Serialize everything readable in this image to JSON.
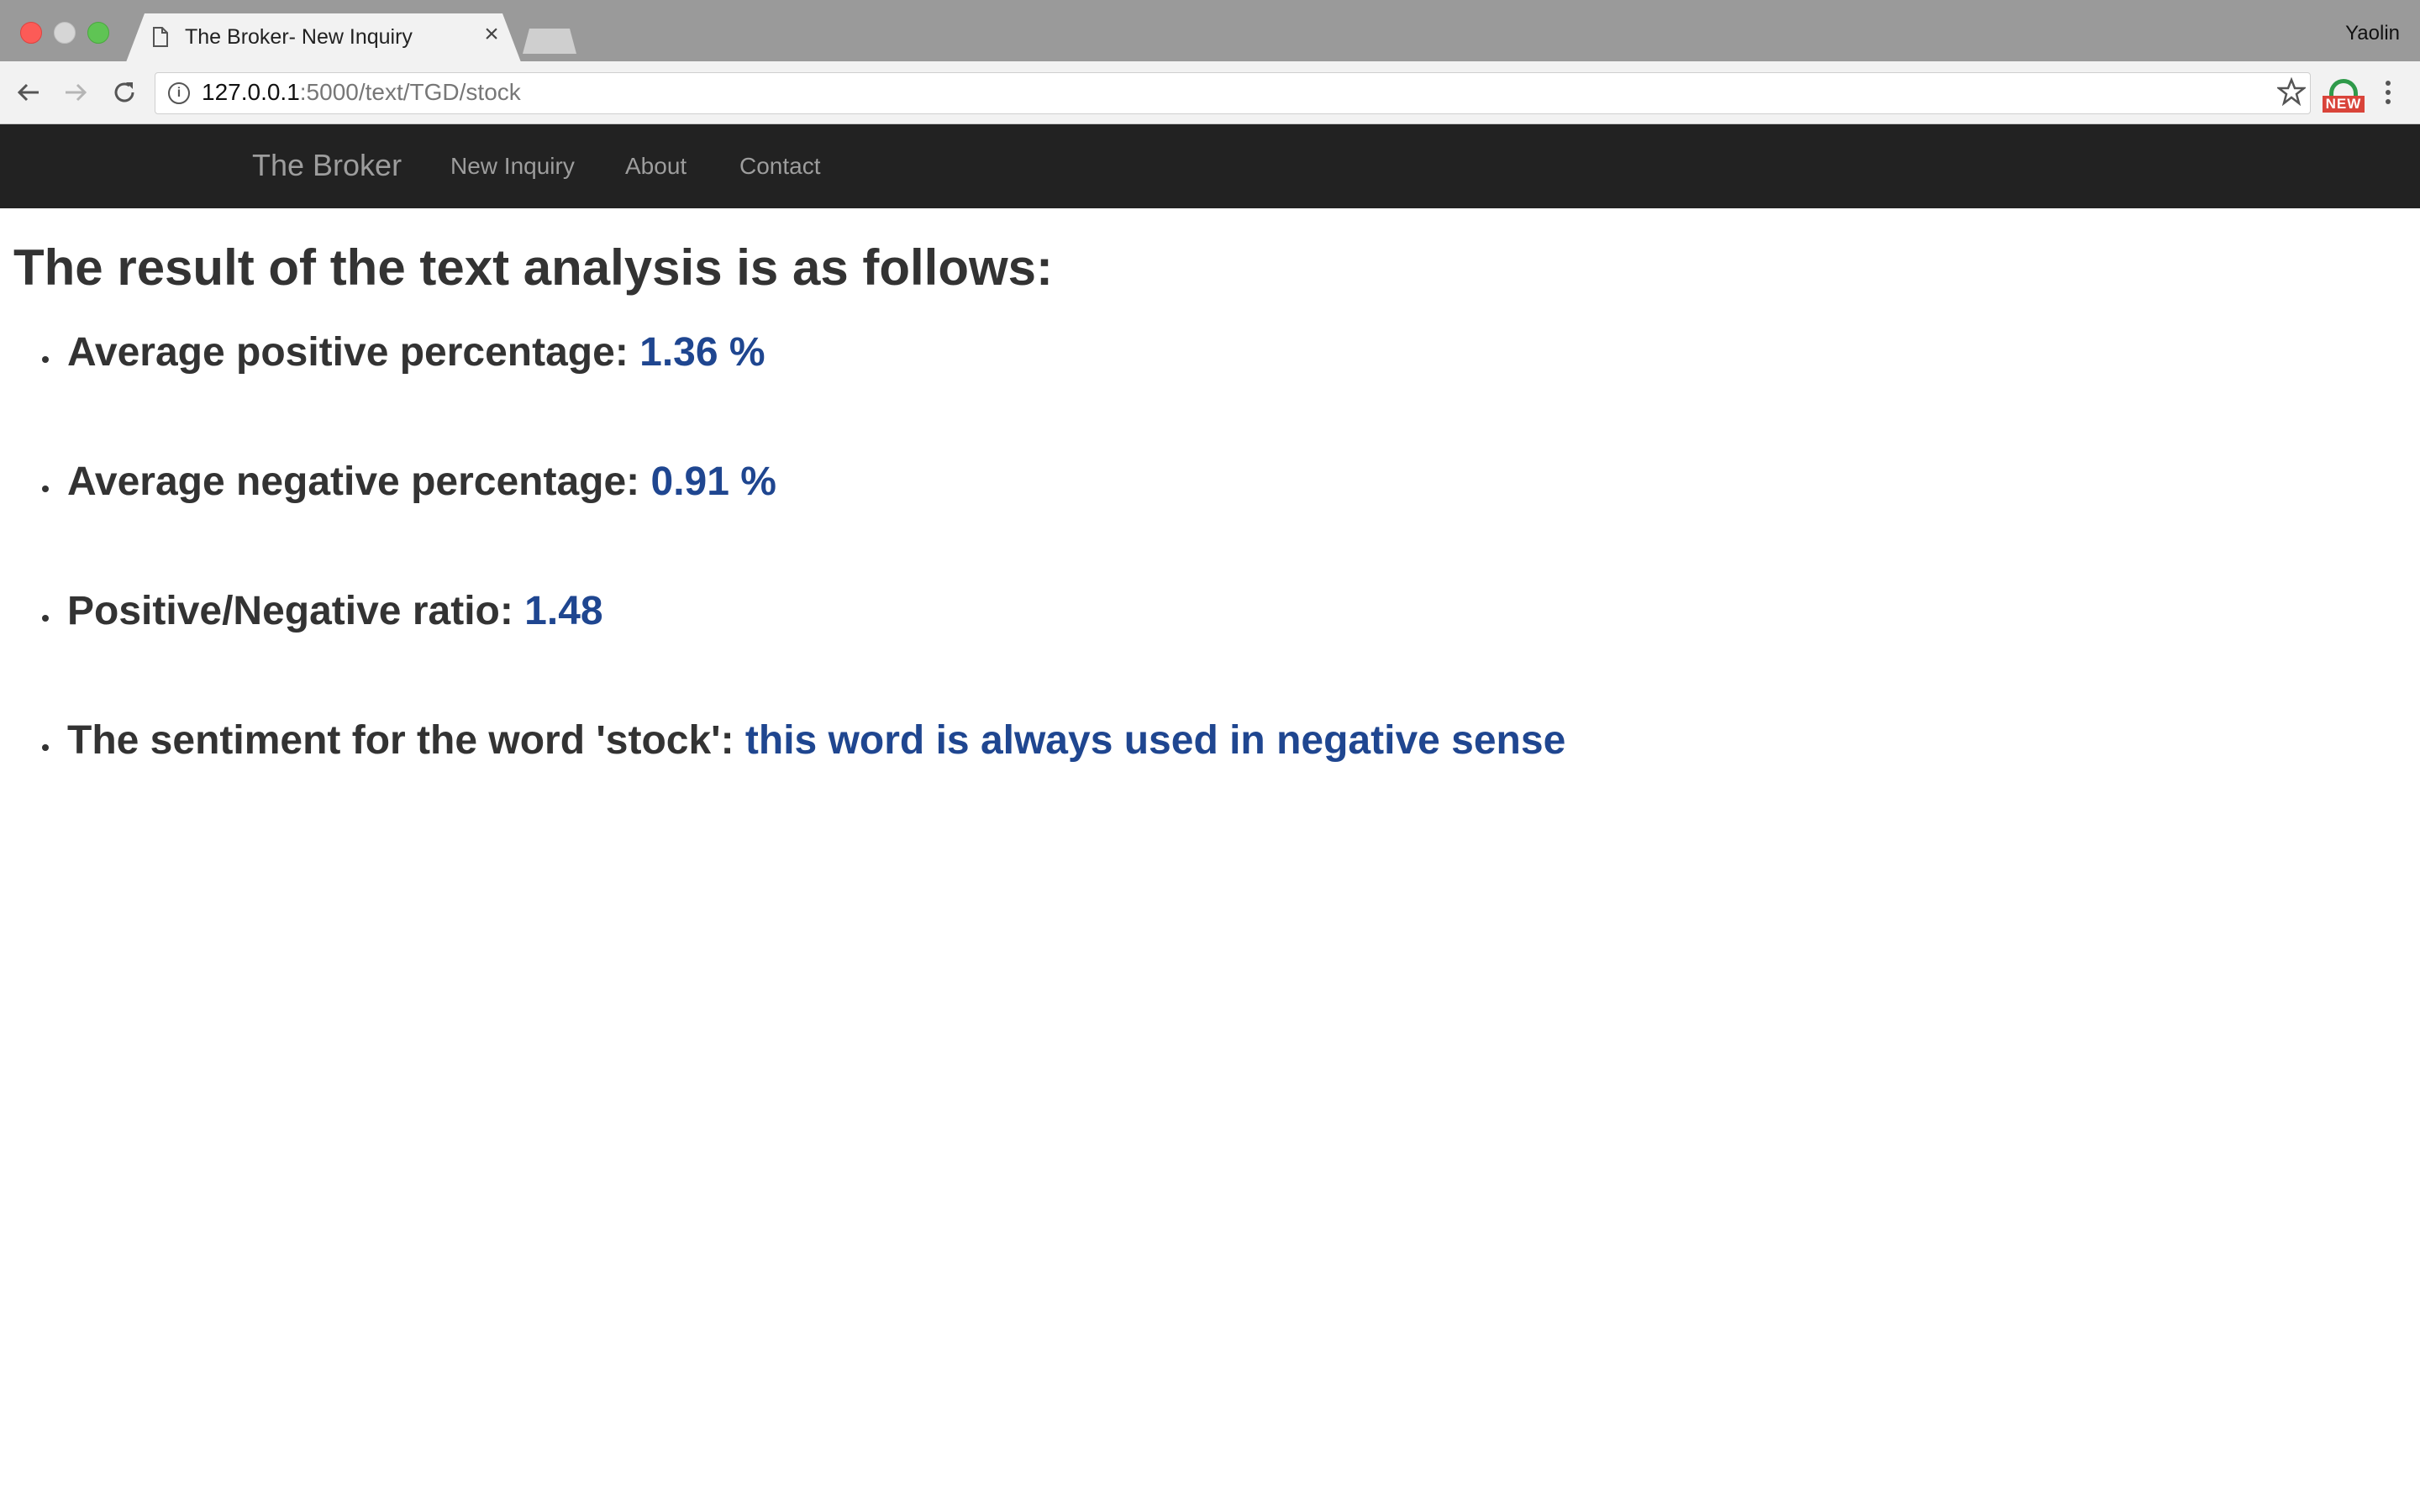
{
  "browser": {
    "tab_title": "The Broker- New Inquiry",
    "tab_close": "×",
    "profile_name": "Yaolin",
    "url_host": "127.0.0.1",
    "url_path": ":5000/text/TGD/stock",
    "extension_badge": "NEW"
  },
  "navbar": {
    "brand": "The Broker",
    "links": [
      "New Inquiry",
      "About",
      "Contact"
    ]
  },
  "content": {
    "heading": "The result of the text analysis is as follows:",
    "results": [
      {
        "label": "Average positive percentage: ",
        "value": "1.36 %"
      },
      {
        "label": "Average negative percentage: ",
        "value": "0.91 %"
      },
      {
        "label": "Positive/Negative ratio: ",
        "value": "1.48"
      },
      {
        "label": "The sentiment for the word 'stock': ",
        "value": "this word is always used in negative sense"
      }
    ]
  },
  "colors": {
    "navbar_bg": "#222222",
    "nav_text": "#9d9d9d",
    "value_text": "#1f4690",
    "body_text": "#333333"
  }
}
